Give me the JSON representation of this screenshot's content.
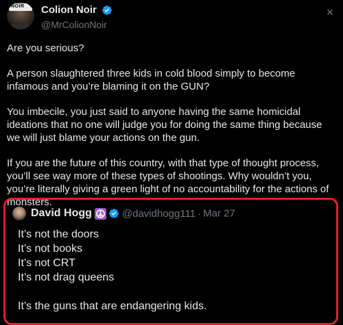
{
  "author": {
    "display_name": "Colion Noir",
    "handle": "@MrColionNoir",
    "avatar_cap_text": "NOIR"
  },
  "close_icon": "×",
  "tweet_paragraphs": [
    "Are you serious?",
    "A person slaughtered three kids in cold blood simply to become infamous and you’re blaming it on the GUN?",
    "You imbecile, you just said to anyone having the same homicidal ideations that no one will judge you for doing the same thing because we will just blame your actions on the gun.",
    "If you are the future of this country, with that type of thought process, you’ll see way more of these types of shootings. Why wouldn’t you, you’re literally giving a green light of no accountability for the actions of monsters."
  ],
  "quoted_tweet": {
    "display_name": "David Hogg",
    "emoji": "☮",
    "handle": "@davidhogg111",
    "separator": "·",
    "date": "Mar 27",
    "lines": [
      "It’s not the doors",
      "It’s not books",
      "It’s not CRT",
      "It’s not drag queens",
      "",
      "It’s the guns that are endangering kids."
    ]
  },
  "colors": {
    "background": "#000000",
    "text": "#e7e9ea",
    "secondary": "#71767b",
    "verified": "#1d9bf0",
    "highlight_border": "#e0202c",
    "peace_badge": "#9b59d0"
  },
  "icons": [
    "verified-badge-icon",
    "close-icon",
    "peace-emoji-icon"
  ]
}
